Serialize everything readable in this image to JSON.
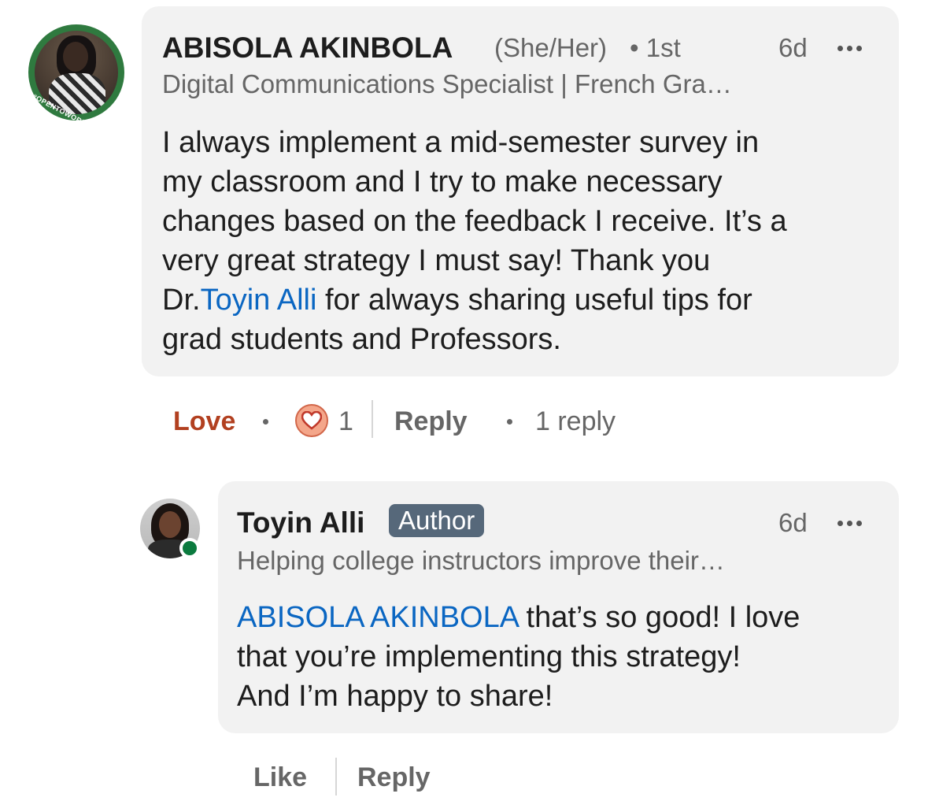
{
  "comment": {
    "author_name": "ABISOLA AKINBOLA",
    "pronouns": "(She/Her)",
    "connection_degree": "• 1st",
    "timestamp": "6d",
    "headline": "Digital Communications Specialist | French Gra…",
    "avatar_frame_text": "#OPENTOWORK",
    "body_before_mention": "I always implement a mid-semester survey in\nmy classroom and I try to make necessary\nchanges based on the feedback I receive. It’s a\nvery great strategy I must say! Thank you\nDr.",
    "mention": "Toyin Alli",
    "body_after_mention": "  for always sharing useful tips for\ngrad students and Professors.",
    "actions": {
      "reaction_label": "Love",
      "reaction_count": "1",
      "reply_label": "Reply",
      "replies_count": "1 reply"
    }
  },
  "reply": {
    "author_name": "Toyin Alli",
    "badge": "Author",
    "timestamp": "6d",
    "headline": "Helping college instructors improve their…",
    "mention": "ABISOLA AKINBOLA",
    "body_after_mention": " that’s so good! I love\nthat you’re implementing this strategy!\nAnd I’m happy to share!",
    "actions": {
      "like_label": "Like",
      "reply_label": "Reply"
    }
  },
  "colors": {
    "bubble_bg": "#f2f2f2",
    "mention": "#0a66c2",
    "love": "#b24020",
    "author_badge": "#56687a",
    "online": "#0b7a3e",
    "open_to_work_ring": "#2f7a3f"
  }
}
